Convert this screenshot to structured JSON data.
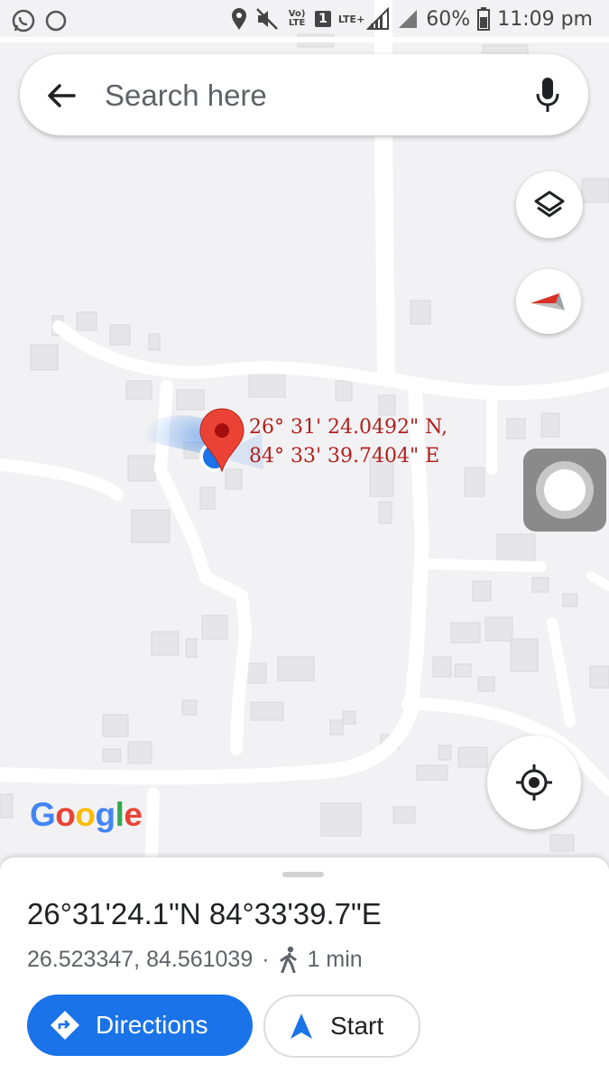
{
  "status_bar": {
    "battery": "60%",
    "time": "11:09 pm",
    "network": "LTE+",
    "volte": "Vo) LTE",
    "sim": "1",
    "icons": [
      "whatsapp-icon",
      "circle-icon",
      "location-icon",
      "mute-icon",
      "volte-icon",
      "sim-icon",
      "lte-signal-icon",
      "signal-icon",
      "battery-icon"
    ]
  },
  "search": {
    "placeholder": "Search here",
    "icons": [
      "back-arrow-icon",
      "mic-icon"
    ]
  },
  "map": {
    "annotation_lat": "26° 31' 24.0492\" N,",
    "annotation_lon": "84° 33' 39.7404\" E",
    "logo": "Google",
    "colors": {
      "road": "#ffffff",
      "land": "#f2f2f4",
      "building": "#e6e6e8",
      "pin": "#ea4335",
      "location_dot": "#1a73e8"
    },
    "controls": [
      "layers-icon",
      "compass-icon",
      "my-location-icon",
      "assistive-touch-icon"
    ]
  },
  "sheet": {
    "title": "26°31'24.1\"N 84°33'39.7\"E",
    "decimal": "26.523347, 84.561039",
    "separator": "·",
    "walk_time": "1 min",
    "directions_label": "Directions",
    "start_label": "Start",
    "accent": "#1a73e8"
  }
}
